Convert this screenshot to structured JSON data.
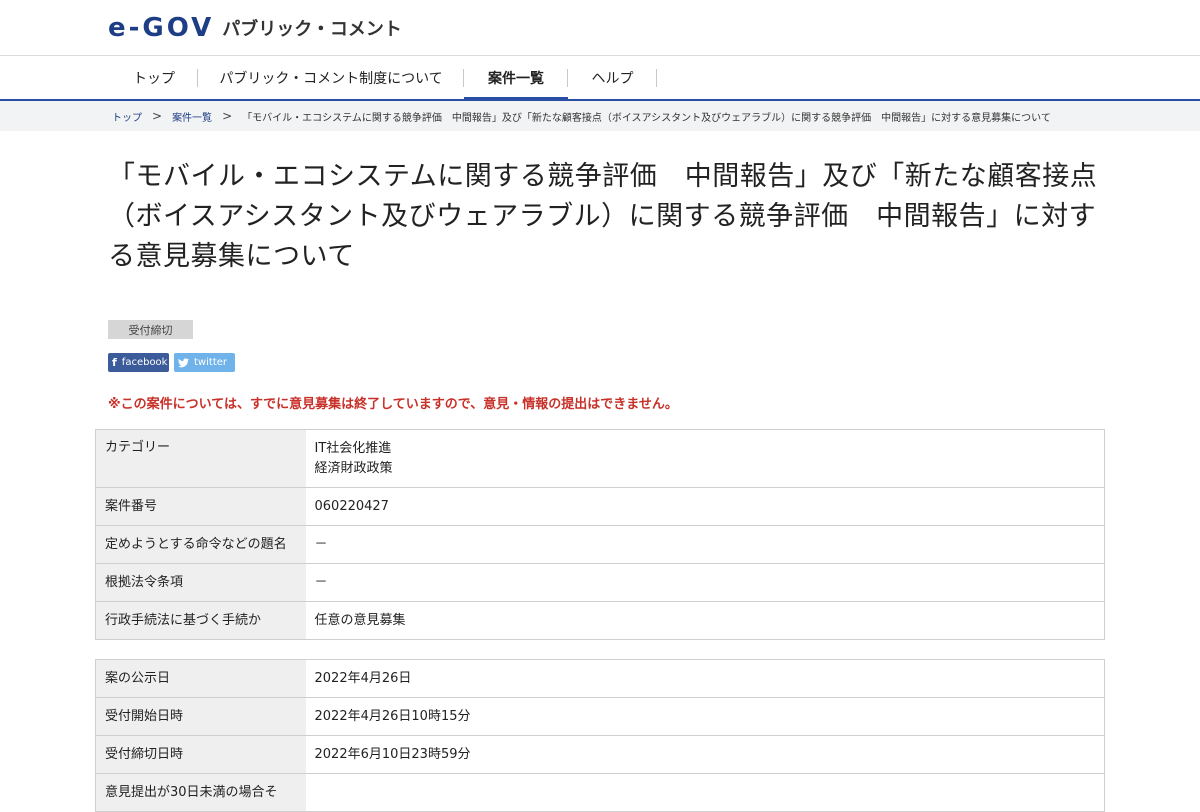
{
  "header": {
    "logo_mark": "e-GOV",
    "site_title": "パブリック・コメント"
  },
  "nav": {
    "items": [
      "トップ",
      "パブリック・コメント制度について",
      "案件一覧",
      "ヘルプ"
    ],
    "active_index": 2
  },
  "breadcrumb": {
    "home": "トップ",
    "list": "案件一覧",
    "current": "「モバイル・エコシステムに関する競争評価　中間報告」及び「新たな顧客接点（ボイスアシスタント及びウェアラブル）に関する競争評価　中間報告」に対する意見募集について"
  },
  "page_title": "「モバイル・エコシステムに関する競争評価　中間報告」及び「新たな顧客接点（ボイスアシスタント及びウェアラブル）に関する競争評価　中間報告」に対する意見募集について",
  "status_badge": "受付締切",
  "share": {
    "facebook": "facebook",
    "twitter": "twitter"
  },
  "notice": "※この案件については、すでに意見募集は終了していますので、意見・情報の提出はできません。",
  "table1": [
    {
      "label": "カテゴリー",
      "value": "IT社会化推進\n経済財政政策"
    },
    {
      "label": "案件番号",
      "value": "060220427"
    },
    {
      "label": "定めようとする命令などの題名",
      "value": "－"
    },
    {
      "label": "根拠法令条項",
      "value": "－"
    },
    {
      "label": "行政手続法に基づく手続か",
      "value": "任意の意見募集"
    }
  ],
  "table2": [
    {
      "label": "案の公示日",
      "value": "2022年4月26日"
    },
    {
      "label": "受付開始日時",
      "value": "2022年4月26日10時15分"
    },
    {
      "label": "受付締切日時",
      "value": "2022年6月10日23時59分"
    },
    {
      "label": "意見提出が30日未満の場合そ",
      "value": ""
    }
  ]
}
